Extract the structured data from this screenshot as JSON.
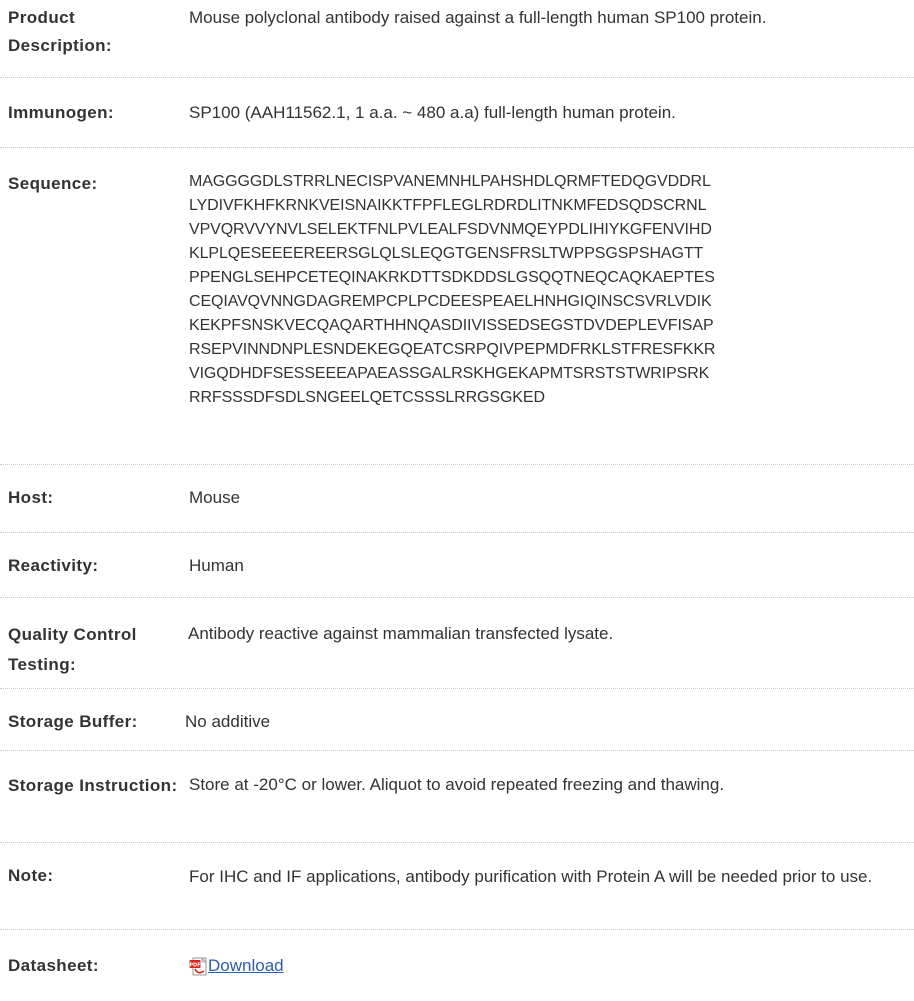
{
  "rows": {
    "product_description": {
      "label": "Product Description:",
      "value": "Mouse polyclonal antibody raised against a full-length human SP100 protein."
    },
    "immunogen": {
      "label": "Immunogen:",
      "value": "SP100 (AAH11562.1, 1 a.a. ~ 480 a.a) full-length human protein."
    },
    "sequence": {
      "label": "Sequence:",
      "lines": [
        "MAGGGGDLSTRRLNECISPVANEMNHLPAHSHDLQRMFTEDQGVDDRL",
        "LYDIVFKHFKRNKVEISNAIKKTFPFLEGLRDRDLITNKMFEDSQDSCRNL",
        "VPVQRVVYNVLSELEKTFNLPVLEALFSDVNMQEYPDLIHIYKGFENVIHD",
        "KLPLQESEEEEREERSGLQLSLEQGTGENSFRSLTWPPSGSPSHAGTT",
        "PPENGLSEHPCETEQINAKRKDTTSDKDDSLGSQQTNEQCAQKAEPTES",
        "CEQIAVQVNNGDAGREMPCPLPCDEESPEAELHNHGIQINSCSVRLVDIK",
        "KEKPFSNSKVECQAQARTHHNQASDIIVISSEDSEGSTDVDEPLEVFISAP",
        "RSEPVINNDNPLESNDEKEGQEATCSRPQIVPEPMDFRKLSTFRESFKKR",
        "VIGQDHDFSESSEEEAPAEASSGALRSKHGEKAPMTSRSTSTWRIPSRK",
        "RRFSSSDFSDLSNGEELQETCSSSLRRGSGKED"
      ]
    },
    "host": {
      "label": "Host:",
      "value": "Mouse"
    },
    "reactivity": {
      "label": "Reactivity:",
      "value": "Human"
    },
    "quality_control": {
      "label": "Quality Control Testing:",
      "value": "Antibody reactive against mammalian transfected lysate."
    },
    "storage_buffer": {
      "label": "Storage Buffer:",
      "value": "No additive"
    },
    "storage_instruction": {
      "label": "Storage Instruction:",
      "value": "Store at -20°C or lower. Aliquot to avoid repeated freezing and thawing."
    },
    "note": {
      "label": "Note:",
      "value": "For IHC and IF applications, antibody purification with Protein A will be needed prior to use."
    },
    "datasheet": {
      "label": "Datasheet:",
      "link_text": "Download",
      "icon": "pdf-icon"
    }
  },
  "colors": {
    "text": "#333333",
    "link": "#2a5db0",
    "divider": "#c8c8c8",
    "pdf_red": "#d9261c"
  }
}
